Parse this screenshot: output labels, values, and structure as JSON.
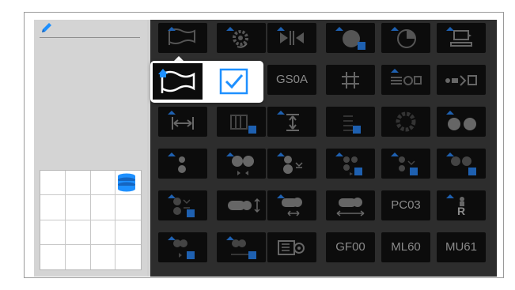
{
  "colors": {
    "palette_bg": "#2d2d2d",
    "tile_bg": "#0c0c0c",
    "accent_blue": "#1e90ff",
    "icon_gray": "#8a8a8a",
    "sidebar_bg": "#d4d4d4"
  },
  "sidebar": {
    "edit_icon": "pencil-icon",
    "storage_icon": "database-icon"
  },
  "popup": {
    "flag_icon": "flag-icon",
    "checkbox_checked": true
  },
  "palette": {
    "rows": [
      [
        {
          "icon": "flag-icon"
        },
        {
          "icon": "gear-refresh-icon"
        },
        {
          "icon": "split-arrows-icon"
        },
        {
          "icon": "circle-icon"
        },
        {
          "icon": "pie-chart-icon"
        },
        {
          "icon": "monitor-icon"
        }
      ],
      [
        {
          "icon": "hidden"
        },
        {
          "icon": "hidden"
        },
        {
          "label": "GS0A"
        },
        {
          "icon": "grid-hash-icon"
        },
        {
          "icon": "lines-circle-icon"
        },
        {
          "icon": "dots-arrows-icon"
        }
      ],
      [
        {
          "icon": "horizontal-resize-icon"
        },
        {
          "icon": "columns-icon"
        },
        {
          "icon": "vertical-resize-icon"
        },
        {
          "icon": "lines-icon"
        },
        {
          "icon": "fan-icon"
        },
        {
          "icon": "two-circles-icon"
        }
      ],
      [
        {
          "icon": "dot-pair-icon"
        },
        {
          "icon": "circles-split-icon"
        },
        {
          "icon": "circles-sort-icon"
        },
        {
          "icon": "triple-circles-icon"
        },
        {
          "icon": "circle-sort-small-icon"
        },
        {
          "icon": "circles-play-icon"
        }
      ],
      [
        {
          "icon": "circles-stack-icon"
        },
        {
          "icon": "toggle-updown-icon"
        },
        {
          "icon": "toggle-arrows-icon"
        },
        {
          "icon": "toggle-wide-arrow-icon"
        },
        {
          "label": "PC03"
        },
        {
          "icon": "person-r-icon"
        }
      ],
      [
        {
          "icon": "circles-fade-icon"
        },
        {
          "icon": "circles-range-icon"
        },
        {
          "icon": "lines-gear-icon"
        },
        {
          "label": "GF00"
        },
        {
          "label": "ML60"
        },
        {
          "label": "MU61"
        }
      ]
    ],
    "labels": {
      "gs0a": "GS0A",
      "pc03": "PC03",
      "gf00": "GF00",
      "ml60": "ML60",
      "mu61": "MU61",
      "r": "R"
    }
  }
}
